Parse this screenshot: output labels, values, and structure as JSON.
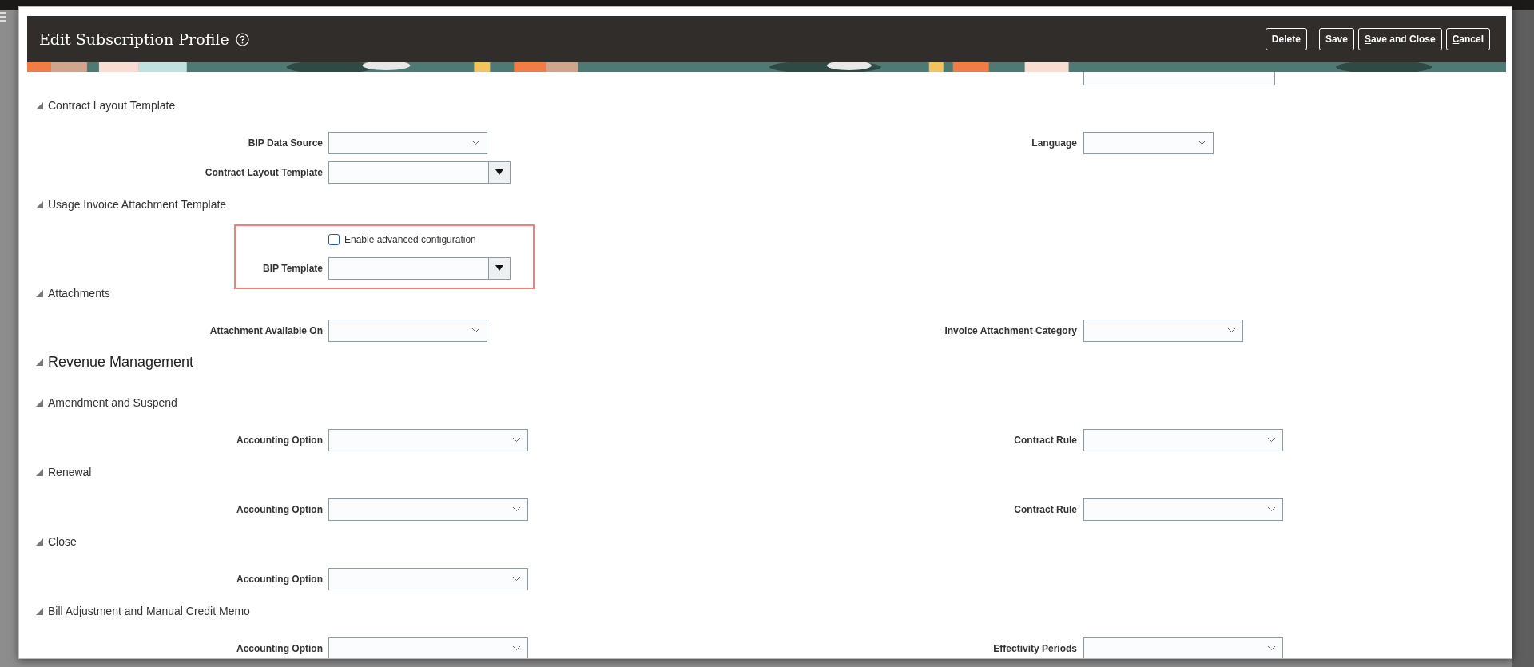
{
  "dialog": {
    "title": "Edit Subscription Profile",
    "button_groups": [
      [
        {
          "label": "Delete",
          "mnemonic": false
        }
      ],
      [
        {
          "label": "Save",
          "mnemonic": false
        },
        {
          "label": "Save and Close",
          "mnemonic": true
        },
        {
          "label": "Cancel",
          "mnemonic": true
        }
      ]
    ]
  },
  "items": [
    {
      "kind": "subsection",
      "title": "Contract Layout Template",
      "expanded": true
    },
    {
      "kind": "field_row",
      "fields": [
        {
          "label": "BIP Data Source",
          "kind": "select"
        },
        {
          "label": "Language",
          "kind": "select"
        }
      ]
    },
    {
      "kind": "field_row",
      "fields": [
        {
          "label": "Contract Layout Template",
          "kind": "combo"
        }
      ]
    },
    {
      "kind": "subsection",
      "title": "Usage Invoice Attachment Template",
      "expanded": true
    },
    {
      "kind": "highlight_group",
      "items": [
        {
          "kind": "checkbox_row",
          "label": "Enable advanced configuration",
          "checked": false
        },
        {
          "kind": "field_row",
          "fields": [
            {
              "label": "BIP Template",
              "kind": "combo"
            }
          ]
        }
      ]
    },
    {
      "kind": "subsection",
      "title": "Attachments",
      "expanded": true
    },
    {
      "kind": "field_row",
      "fields": [
        {
          "label": "Attachment Available On",
          "kind": "select"
        },
        {
          "label": "Invoice Attachment Category",
          "kind": "select"
        }
      ]
    },
    {
      "kind": "section",
      "title": "Revenue Management",
      "expanded": true
    },
    {
      "kind": "subsection",
      "title": "Amendment and Suspend",
      "expanded": true
    },
    {
      "kind": "field_row",
      "fields": [
        {
          "label": "Accounting Option",
          "kind": "select"
        },
        {
          "label": "Contract Rule",
          "kind": "select"
        }
      ]
    },
    {
      "kind": "subsection",
      "title": "Renewal",
      "expanded": true
    },
    {
      "kind": "field_row",
      "fields": [
        {
          "label": "Accounting Option",
          "kind": "select"
        },
        {
          "label": "Contract Rule",
          "kind": "select"
        }
      ]
    },
    {
      "kind": "subsection",
      "title": "Close",
      "expanded": true
    },
    {
      "kind": "field_row",
      "fields": [
        {
          "label": "Accounting Option",
          "kind": "select"
        }
      ]
    },
    {
      "kind": "subsection",
      "title": "Bill Adjustment and Manual Credit Memo",
      "expanded": true
    },
    {
      "kind": "field_row",
      "fields": [
        {
          "label": "Accounting Option",
          "kind": "select"
        },
        {
          "label": "Effectivity Periods",
          "kind": "select"
        }
      ]
    }
  ]
}
